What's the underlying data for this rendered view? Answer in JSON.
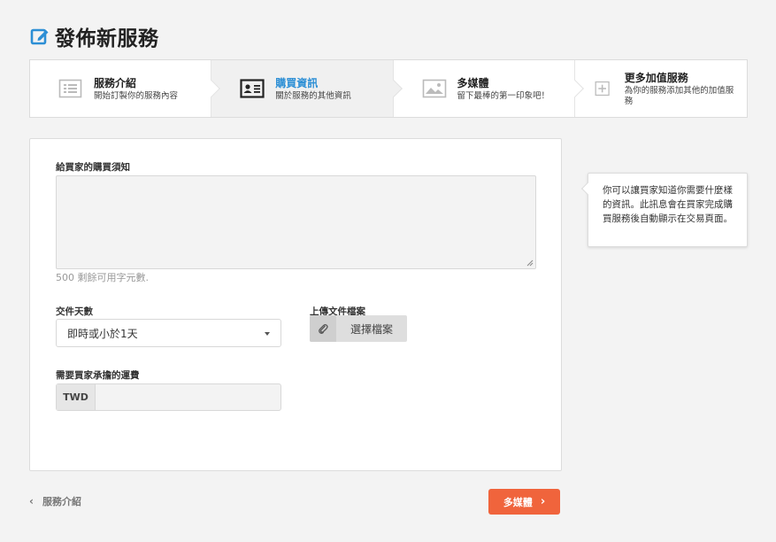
{
  "page": {
    "title": "發佈新服務"
  },
  "steps": [
    {
      "title": "服務介紹",
      "desc": "開始訂製你的服務內容",
      "icon": "list-icon",
      "active": false
    },
    {
      "title": "購買資訊",
      "desc": "關於服務的其他資訊",
      "icon": "id-card-icon",
      "active": true
    },
    {
      "title": "多媒體",
      "desc": "留下最棒的第一印象吧！",
      "icon": "image-icon",
      "active": false
    },
    {
      "title": "更多加值服務",
      "desc": "為你的服務添加其他的加值服務",
      "icon": "plus-square-icon",
      "active": false
    }
  ],
  "form": {
    "notice_label": "給買家的購買須知",
    "notice_value": "",
    "char_count": "500 剩餘可用字元數.",
    "days_label": "交件天數",
    "days_value": "即時或小於1天",
    "upload_label": "上傳文件檔案",
    "upload_button": "選擇檔案",
    "shipping_label": "需要買家承擔的運費",
    "currency": "TWD",
    "shipping_value": ""
  },
  "tooltip": {
    "text": "你可以讓買家知道你需要什麼樣的資訊。此訊息會在買家完成購買服務後自動顯示在交易頁面。"
  },
  "nav": {
    "back_label": "服務介紹",
    "next_label": "多媒體"
  },
  "colors": {
    "accent": "#2d8fd5",
    "next_button": "#f0643c"
  }
}
